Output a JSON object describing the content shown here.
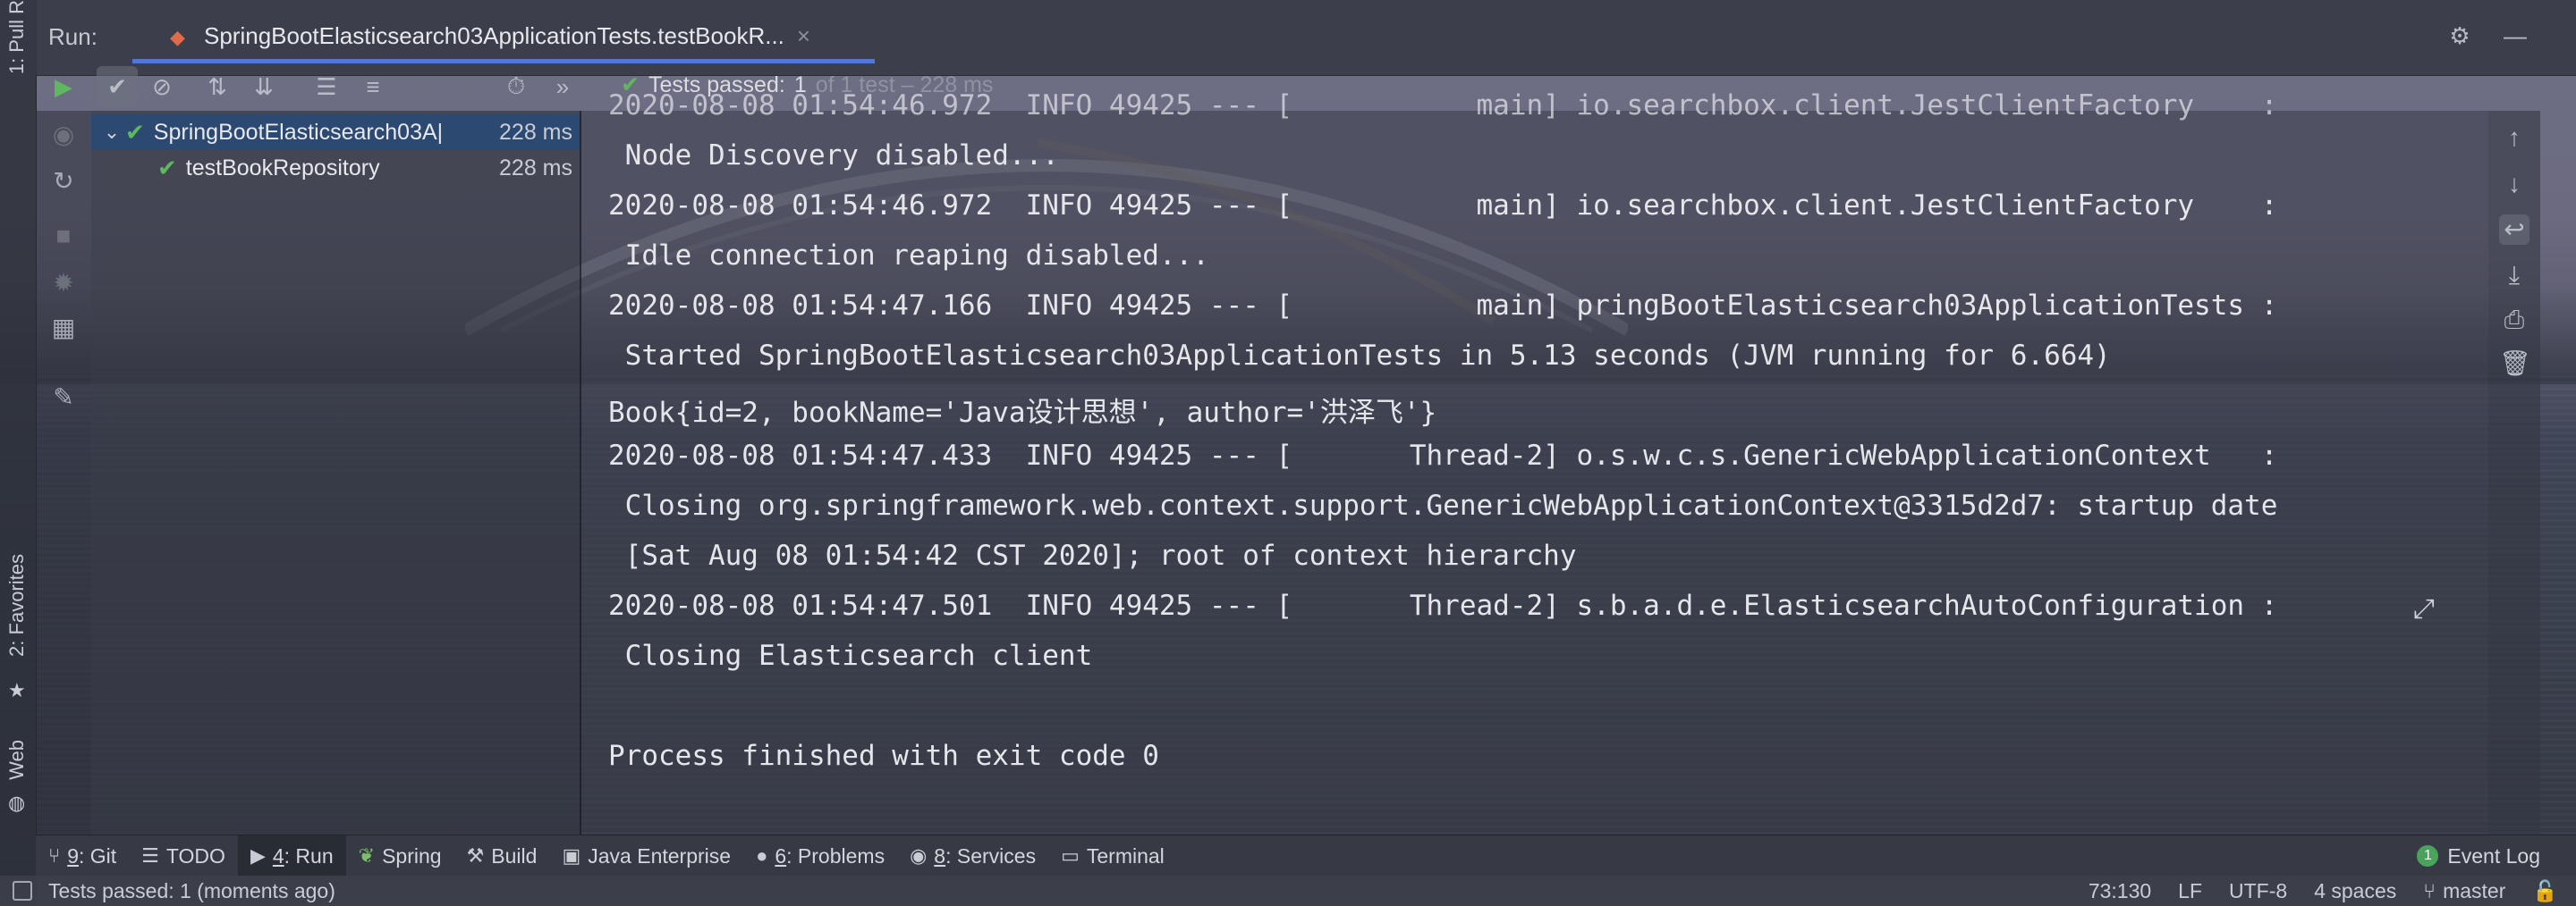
{
  "theme": {
    "accent": "#4e79d4",
    "success": "#5fb85f"
  },
  "leftStrip": {
    "pullRequests": "1: Pull R",
    "favorites": "2: Favorites",
    "web": "Web"
  },
  "run": {
    "label": "Run:",
    "tabTitle": "SpringBootElasticsearch03ApplicationTests.testBookR...",
    "tabClose": "×"
  },
  "toolbar": {
    "statusPassed": "Tests passed:",
    "statusCount": "1",
    "statusRest": "of 1 test – 228 ms"
  },
  "tree": {
    "items": [
      {
        "label": "SpringBootElasticsearch03A|",
        "time": "228 ms"
      },
      {
        "label": "testBookRepository",
        "time": "228 ms"
      }
    ]
  },
  "console": {
    "lines": [
      "2020-08-08 01:54:46.972  INFO 49425 --- [           main] io.searchbox.client.JestClientFactory    :",
      " Node Discovery disabled...",
      "2020-08-08 01:54:46.972  INFO 49425 --- [           main] io.searchbox.client.JestClientFactory    :",
      " Idle connection reaping disabled...",
      "2020-08-08 01:54:47.166  INFO 49425 --- [           main] pringBootElasticsearch03ApplicationTests :",
      " Started SpringBootElasticsearch03ApplicationTests in 5.13 seconds (JVM running for 6.664)",
      "Book{id=2, bookName='Java设计思想', author='洪泽飞'}",
      "2020-08-08 01:54:47.433  INFO 49425 --- [       Thread-2] o.s.w.c.s.GenericWebApplicationContext   :",
      " Closing org.springframework.web.context.support.GenericWebApplicationContext@3315d2d7: startup date",
      " [Sat Aug 08 01:54:42 CST 2020]; root of context hierarchy",
      "2020-08-08 01:54:47.501  INFO 49425 --- [       Thread-2] s.b.a.d.e.ElasticsearchAutoConfiguration :",
      " Closing Elasticsearch client",
      "",
      "Process finished with exit code 0"
    ]
  },
  "bottomTabs": [
    {
      "key": "9",
      "label": ": Git"
    },
    {
      "key": "",
      "label": "TODO"
    },
    {
      "key": "4",
      "label": ": Run"
    },
    {
      "key": "",
      "label": "Spring"
    },
    {
      "key": "",
      "label": "Build"
    },
    {
      "key": "",
      "label": "Java Enterprise"
    },
    {
      "key": "6",
      "label": ": Problems"
    },
    {
      "key": "8",
      "label": ": Services"
    },
    {
      "key": "",
      "label": "Terminal"
    }
  ],
  "eventLog": {
    "count": "1",
    "label": "Event Log"
  },
  "statusbar": {
    "message": "Tests passed: 1 (moments ago)",
    "position": "73:130",
    "lineSep": "LF",
    "encoding": "UTF-8",
    "indent": "4 spaces",
    "branch": "master"
  }
}
